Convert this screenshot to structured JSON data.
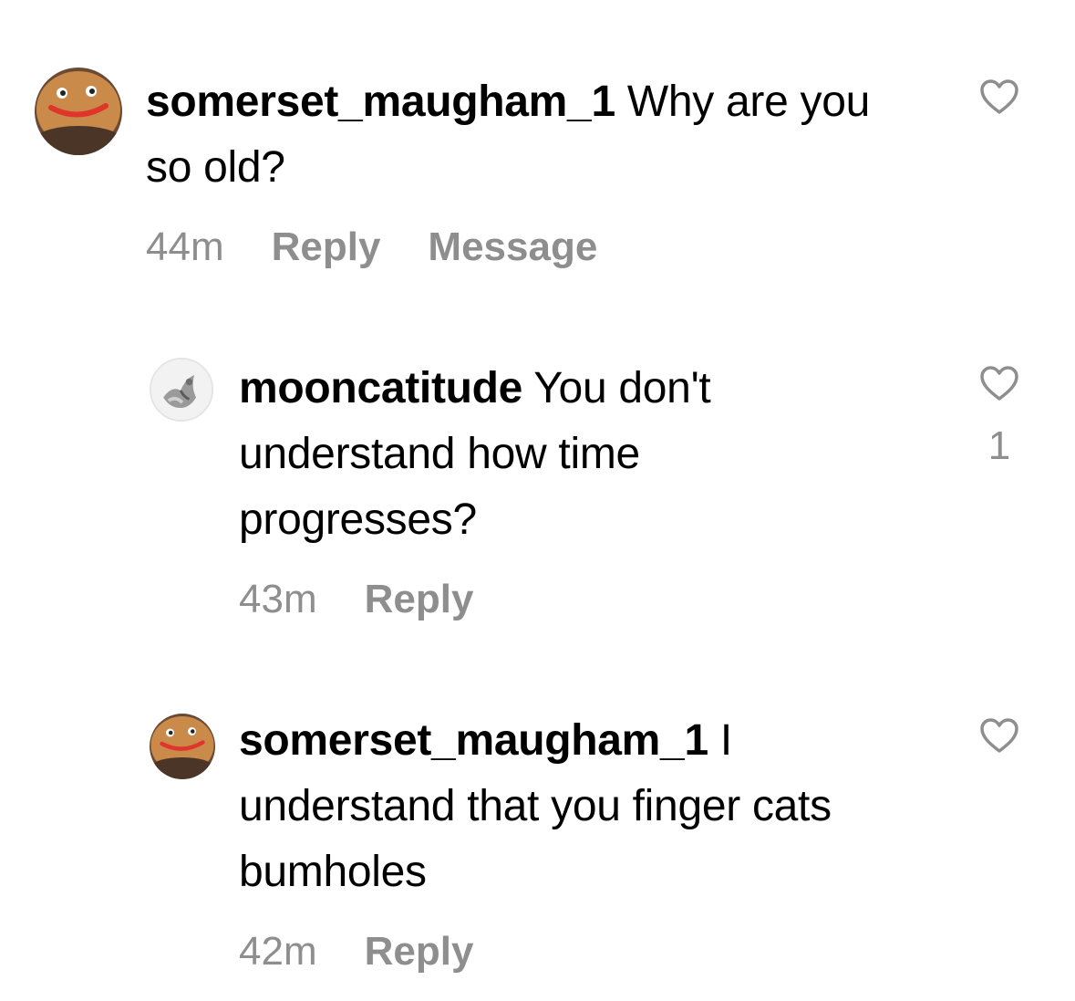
{
  "comments": [
    {
      "username": "somerset_maugham_1",
      "text": "Why are you so old?",
      "time": "44m",
      "reply_label": "Reply",
      "message_label": "Message",
      "avatar": "cookie-face-avatar",
      "likes": ""
    },
    {
      "username": "mooncatitude",
      "text": "You don't understand how time progresses?",
      "time": "43m",
      "reply_label": "Reply",
      "avatar": "grey-photo-avatar",
      "likes": "1"
    },
    {
      "username": "somerset_maugham_1",
      "text": "I understand that you finger cats bumholes",
      "time": "42m",
      "reply_label": "Reply",
      "avatar": "cookie-face-avatar",
      "likes": ""
    }
  ],
  "icons": {
    "like": "heart-outline-icon"
  },
  "colors": {
    "text": "#000000",
    "muted": "#8e8e8e",
    "background": "#ffffff"
  }
}
